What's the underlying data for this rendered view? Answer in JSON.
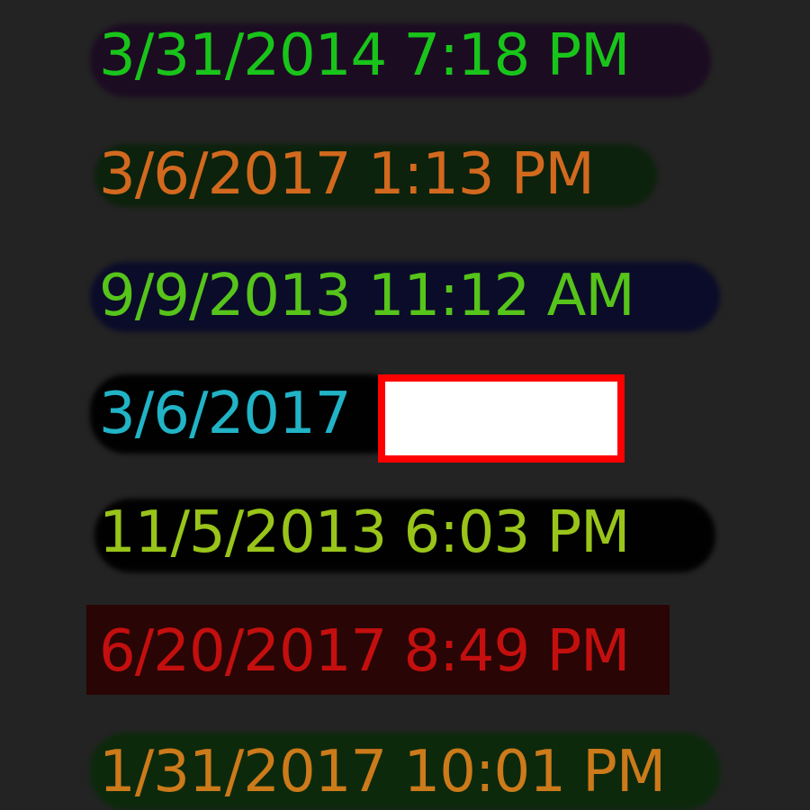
{
  "dates": [
    {
      "text": "3/31/2014 7:18 PM",
      "color": "#19c41a",
      "highlight": "#1c0b22"
    },
    {
      "text": "3/6/2017 1:13 PM",
      "color": "#d2691e",
      "highlight": "#0b220b"
    },
    {
      "text": "9/9/2013 11:12 AM",
      "color": "#56c41a",
      "highlight": "#0a0b2a"
    },
    {
      "text": "3/6/2017",
      "color": "#21b3c6",
      "highlight": "#000000",
      "redacted": true
    },
    {
      "text": "11/5/2013 6:03 PM",
      "color": "#99c41a",
      "highlight": "#000000"
    },
    {
      "text": "6/20/2017 8:49 PM",
      "color": "#c40f0f",
      "highlight": "#2a0404"
    },
    {
      "text": "1/31/2017 10:01 PM",
      "color": "#cc7a1a",
      "highlight": "#0b2a0b"
    }
  ]
}
